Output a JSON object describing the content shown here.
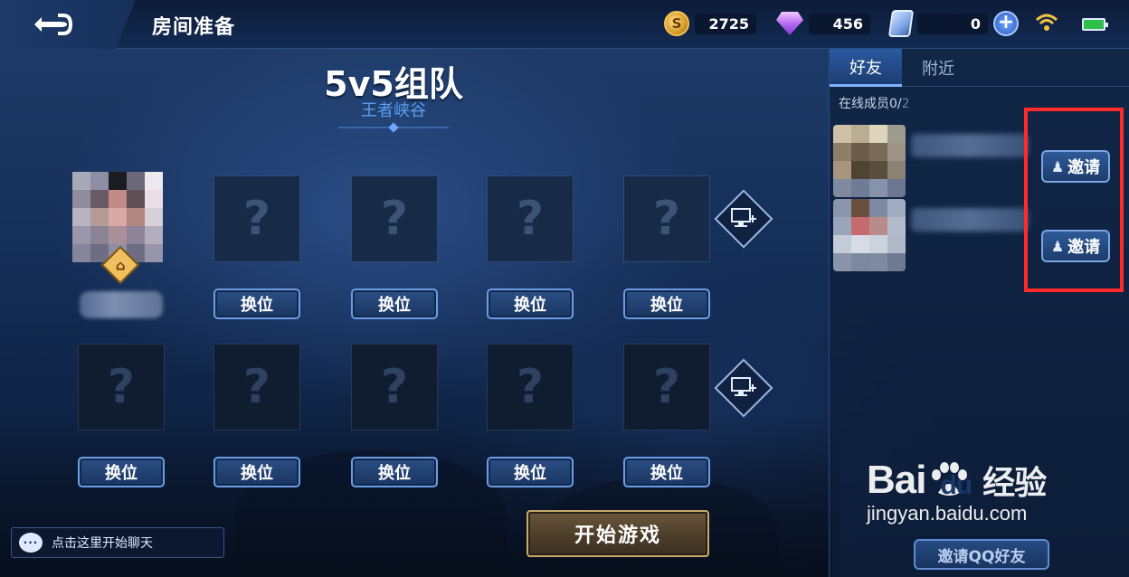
{
  "header": {
    "title": "房间准备",
    "gold": "2725",
    "diamonds": "456",
    "coupons": "0"
  },
  "mode": {
    "title": "5v5组队",
    "map": "王者峡谷"
  },
  "team": {
    "swap_label": "换位",
    "empty_slot_glyph": "?",
    "host_badge_icon": "house-icon"
  },
  "friends_panel": {
    "tabs": [
      {
        "label": "好友",
        "active": true
      },
      {
        "label": "附近",
        "active": false
      }
    ],
    "online_label": "在线成员0/",
    "online_total": "2",
    "invite_label": "邀请",
    "invite_qq_label": "邀请QQ好友"
  },
  "chat": {
    "placeholder": "点击这里开始聊天"
  },
  "start_button": {
    "label": "开始游戏"
  },
  "watermark": {
    "brand": "Bai",
    "brand_du": "du",
    "brand_cn": "经验",
    "url": "jingyan.baidu.com"
  },
  "colors": {
    "highlight": "#ff2a2a",
    "accent": "#5b9ef0"
  }
}
